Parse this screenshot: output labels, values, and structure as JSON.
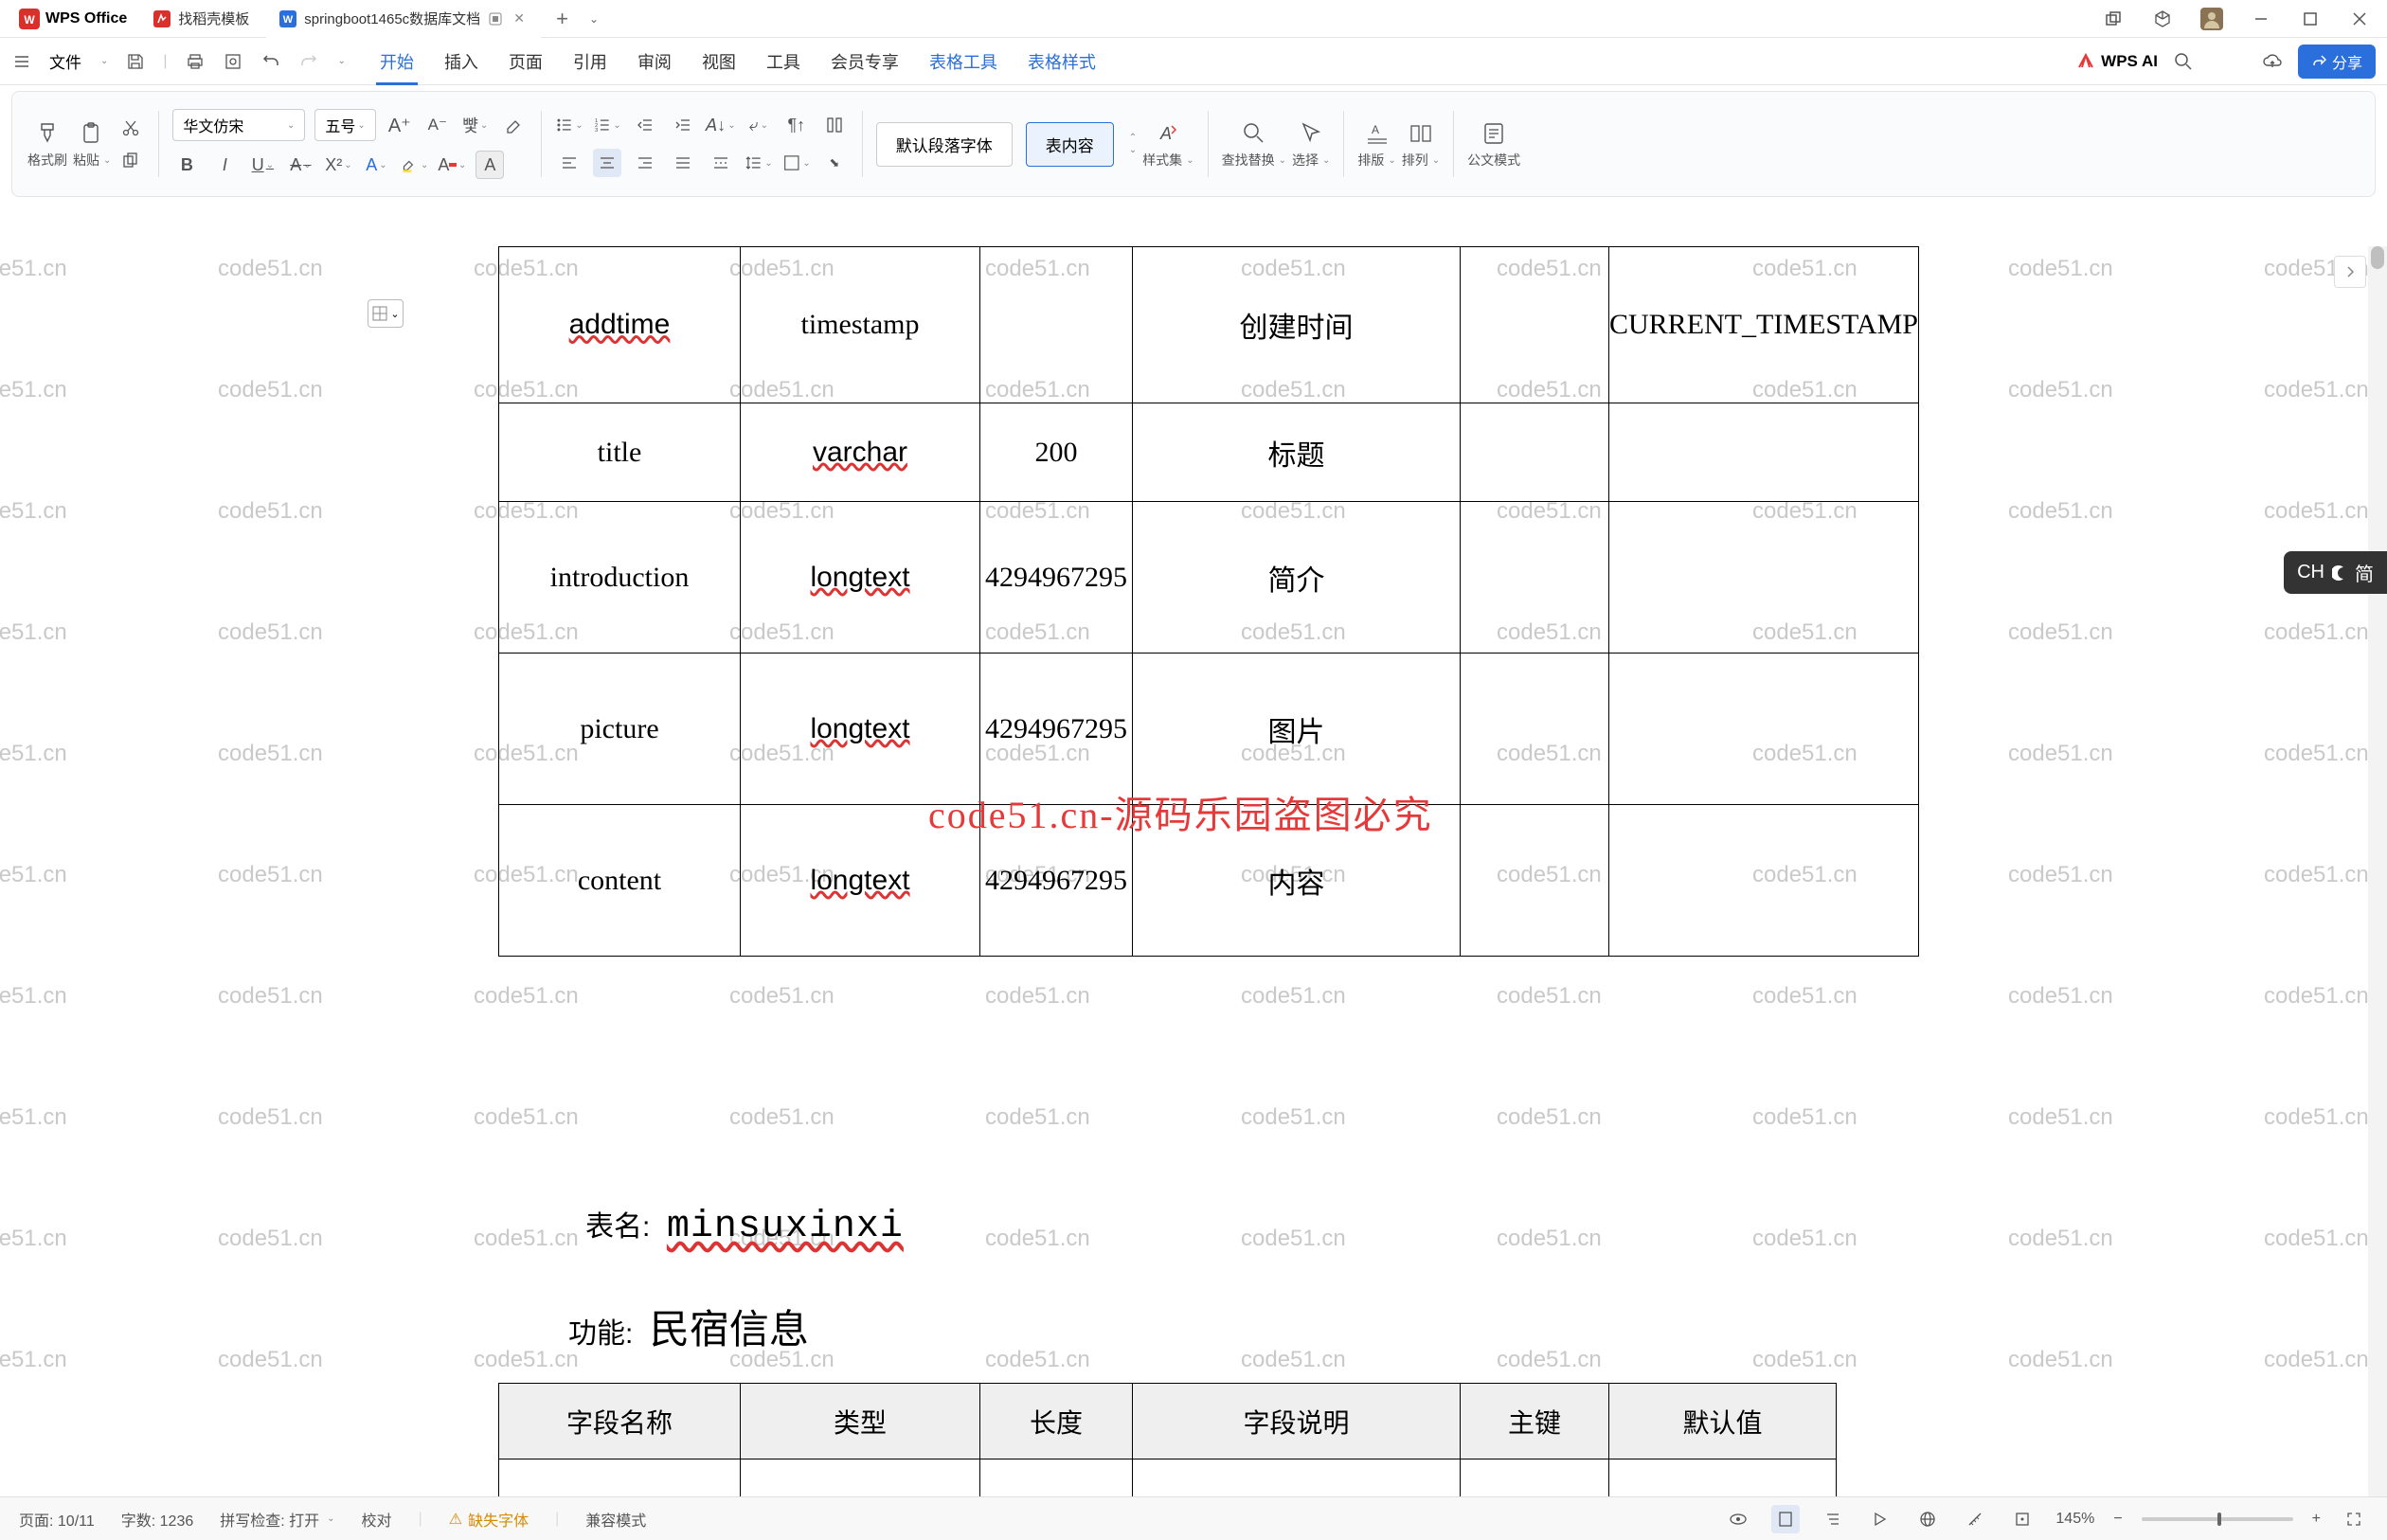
{
  "titlebar": {
    "app_name": "WPS Office",
    "tabs": [
      {
        "label": "找稻壳模板"
      },
      {
        "label": "springboot1465c数据库文档"
      }
    ],
    "active_tab_index": 1
  },
  "menubar": {
    "file_label": "文件",
    "tabs": [
      "开始",
      "插入",
      "页面",
      "引用",
      "审阅",
      "视图",
      "工具",
      "会员专享",
      "表格工具",
      "表格样式"
    ],
    "active_index": 0,
    "blue_indexes": [
      8,
      9
    ],
    "wps_ai_label": "WPS AI",
    "share_label": "分享"
  },
  "ribbon": {
    "format_brush": "格式刷",
    "paste": "粘贴",
    "font_name": "华文仿宋",
    "font_size": "五号",
    "para_style_default": "默认段落字体",
    "para_style_content": "表内容",
    "styles_label": "样式集",
    "find_replace": "查找替换",
    "select": "选择",
    "rows": "排版",
    "cols": "排列",
    "gongwen": "公文模式"
  },
  "table1": {
    "rows": [
      {
        "c1": "addtime",
        "c2": "timestamp",
        "c3": "",
        "c4": "创建时间",
        "c5": "",
        "c6": "CURRENT_TIMESTAMP"
      },
      {
        "c1": "title",
        "c2": "varchar",
        "c3": "200",
        "c4": "标题",
        "c5": "",
        "c6": ""
      },
      {
        "c1": "introduction",
        "c2": "longtext",
        "c3": "4294967295",
        "c4": "简介",
        "c5": "",
        "c6": ""
      },
      {
        "c1": "picture",
        "c2": "longtext",
        "c3": "4294967295",
        "c4": "图片",
        "c5": "",
        "c6": ""
      },
      {
        "c1": "content",
        "c2": "longtext",
        "c3": "4294967295",
        "c4": "内容",
        "c5": "",
        "c6": ""
      }
    ]
  },
  "section": {
    "table_name_label": "表名:",
    "table_name_value": "minsuxinxi",
    "function_label": "功能:",
    "function_value": "民宿信息"
  },
  "table2": {
    "headers": [
      "字段名称",
      "类型",
      "长度",
      "字段说明",
      "主键",
      "默认值"
    ]
  },
  "red_overlay": "code51.cn-源码乐园盗图必究",
  "watermark_text": "code51.cn",
  "statusbar": {
    "page": "页面: 10/11",
    "words": "字数: 1236",
    "spell": "拼写检查: 打开",
    "proof": "校对",
    "missing_font": "缺失字体",
    "compat": "兼容模式",
    "zoom": "145%"
  },
  "ime": {
    "lang": "CH",
    "mode": "简"
  }
}
